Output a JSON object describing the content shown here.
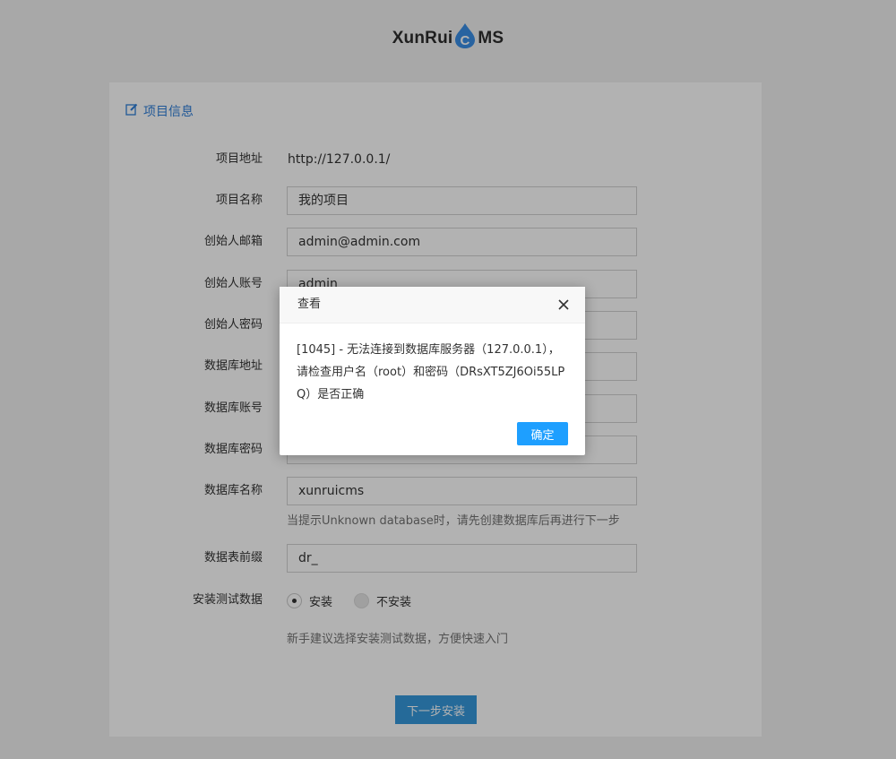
{
  "logo": {
    "left_text": "XunRui",
    "drop_letter": "C",
    "right_text": "MS"
  },
  "section": {
    "title": "项目信息",
    "icon": "edit-icon"
  },
  "fields": [
    {
      "label": "项目地址",
      "value": "http://127.0.0.1/"
    },
    {
      "label": "项目名称",
      "value": "我的项目"
    },
    {
      "label": "创始人邮箱",
      "value": "admin@admin.com"
    },
    {
      "label": "创始人账号",
      "value": "admin"
    },
    {
      "label": "创始人密码",
      "value": ""
    },
    {
      "label": "数据库地址",
      "value": ""
    },
    {
      "label": "数据库账号",
      "value": ""
    },
    {
      "label": "数据库密码",
      "value": ""
    },
    {
      "label": "数据库名称",
      "value": "xunruicms",
      "hint": "当提示Unknown database时，请先创建数据库后再进行下一步"
    },
    {
      "label": "数据表前缀",
      "value": "dr_"
    }
  ],
  "test_data": {
    "label": "安装测试数据",
    "options": [
      "安装",
      "不安装"
    ],
    "selected": "安装",
    "hint": "新手建议选择安装测试数据，方便快速入门"
  },
  "next_button": "下一步安装",
  "dialog": {
    "title": "查看",
    "message": "[1045] - 无法连接到数据库服务器（127.0.0.1），请检查用户名（root）和密码（DRsXT5ZJ6Oi55LPQ）是否正确",
    "ok_button": "确定"
  },
  "colors": {
    "accent": "#3598dc",
    "link": "#2f7ed8",
    "dialog_button": "#1e9fff",
    "logo_drop": "#3a8ee6"
  }
}
